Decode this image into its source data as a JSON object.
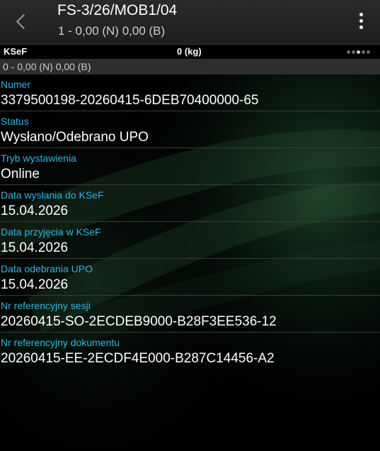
{
  "header": {
    "title": "FS-3/26/MOB1/04",
    "subtitle": "1 - 0,00 (N) 0,00 (B)",
    "back_icon": "chevron-left-icon",
    "menu_icon": "overflow-menu-icon"
  },
  "tab": {
    "label": "KSeF",
    "weight": "0 (kg)",
    "pages": 5,
    "active_page": 3
  },
  "summary": "0 - 0,00 (N) 0,00 (B)",
  "fields": [
    {
      "label": "Numer",
      "value": "3379500198-20260415-6DEB70400000-65"
    },
    {
      "label": "Status",
      "value": "Wysłano/Odebrano UPO"
    },
    {
      "label": "Tryb wystawienia",
      "value": "Online"
    },
    {
      "label": "Data wysłania do KSeF",
      "value": "15.04.2026"
    },
    {
      "label": "Data przyjęcia w KSeF",
      "value": "15.04.2026"
    },
    {
      "label": "Data odebrania UPO",
      "value": "15.04.2026"
    },
    {
      "label": "Nr referencyjny sesji",
      "value": "20260415-SO-2ECDEB9000-B28F3EE536-12"
    },
    {
      "label": "Nr referencyjny dokumentu",
      "value": "20260415-EE-2ECDF4E000-B287C14456-A2"
    }
  ],
  "colors": {
    "label": "#33b5e5",
    "value": "#ffffff",
    "background": "#000000",
    "action_bar": "#262626",
    "summary_strip": "#2e2e2e",
    "background_glow": "#1f4a2e"
  }
}
